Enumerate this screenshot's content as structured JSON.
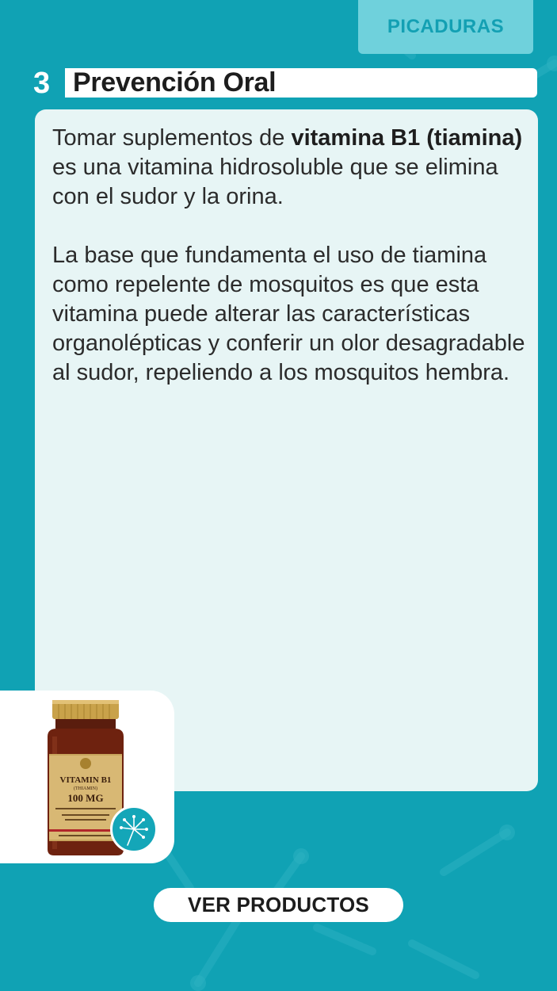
{
  "header": {
    "category_tab": "PICADURAS",
    "section_number": "3",
    "section_title": "Prevención Oral"
  },
  "content": {
    "p1_before": "Tomar suplementos de ",
    "p1_bold": "vitamina B1 (tiamina)",
    "p1_after": " es una vitamina hidrosoluble que se elimina con el sudor y la orina.",
    "p2": "La base que fundamenta el uso de tiamina como repelente de mosquitos es que esta vitamina puede alterar las características organolépticas y conferir un olor desagradable al sudor, repeliendo a los mosquitos hembra."
  },
  "product": {
    "label_line1": "VITAMIN B1",
    "label_line2": "(THIAMIN)",
    "label_line3": "100 MG",
    "icon": "product-bottle-icon",
    "badge_icon": "dandelion-icon"
  },
  "cta": {
    "label": "VER PRODUCTOS"
  },
  "colors": {
    "background": "#10a2b4",
    "tab": "#6fd1dc",
    "card": "#e7f5f5"
  }
}
